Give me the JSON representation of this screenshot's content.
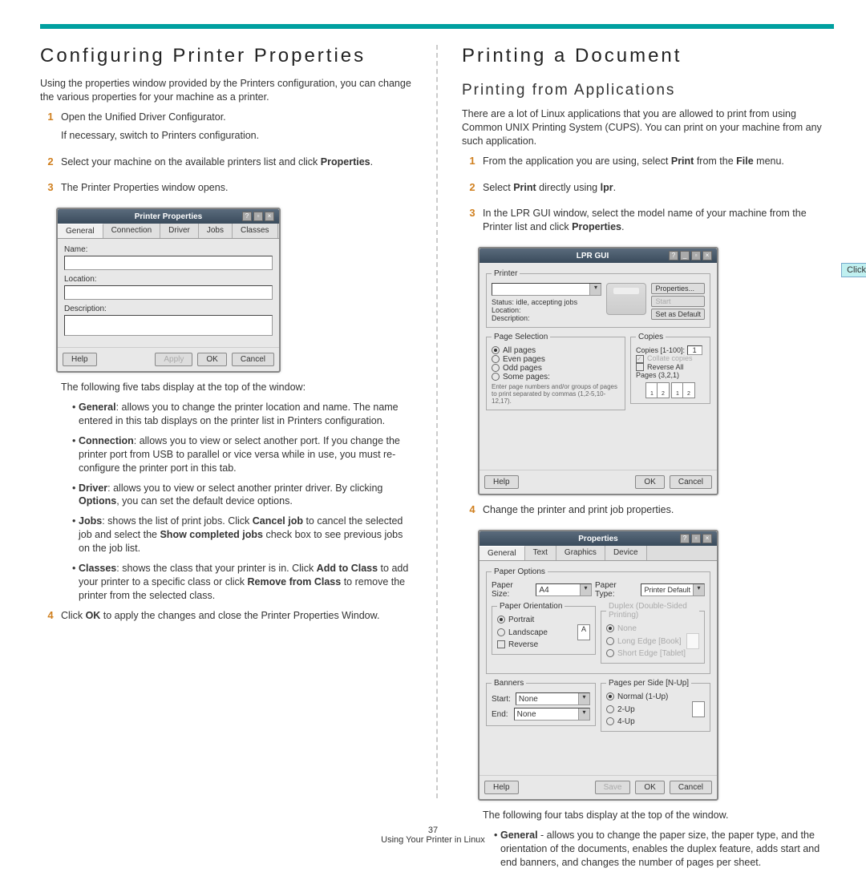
{
  "left": {
    "h1": "Configuring Printer Properties",
    "intro": "Using the properties window provided by the Printers configuration, you can change the various properties for your machine as a printer.",
    "step1a": "Open the Unified Driver Configurator.",
    "step1b": "If necessary, switch to Printers configuration.",
    "step2a": "Select your machine on the available printers list and click ",
    "step2b": "Properties",
    "step2c": ".",
    "step3": "The Printer Properties window opens.",
    "tabs_intro": "The following five tabs display at the top of the window:",
    "tab_general_b": "General",
    "tab_general": ": allows you to change the printer location and name. The name entered in this tab displays on the printer list in Printers configuration.",
    "tab_connection_b": "Connection",
    "tab_connection": ": allows you to view or select another port. If you change the printer port from USB to parallel or vice versa while in use, you must re-configure the printer port in this tab.",
    "tab_driver_b": "Driver",
    "tab_driver_a": ": allows you to view or select another printer driver. By clicking ",
    "tab_driver_opt": "Options",
    "tab_driver_c": ", you can set the default device options.",
    "tab_jobs_b": "Jobs",
    "tab_jobs_a": ": shows the list of print jobs. Click ",
    "tab_jobs_cancel": "Cancel job",
    "tab_jobs_c": " to cancel the selected job and select the ",
    "tab_jobs_show": "Show completed jobs",
    "tab_jobs_d": " check box to see previous jobs on the job list.",
    "tab_classes_b": "Classes",
    "tab_classes_a": ": shows the class that your printer is in. Click ",
    "tab_classes_add": "Add to Class",
    "tab_classes_c": " to add your printer to a specific class or click ",
    "tab_classes_rem": "Remove from Class",
    "tab_classes_d": " to remove the printer from the selected class.",
    "step4a": "Click ",
    "step4b": "OK",
    "step4c": " to apply the changes and close the Printer Properties Window."
  },
  "right": {
    "h1": "Printing a Document",
    "h2": "Printing from Applications",
    "intro": "There are a lot of Linux applications that you are allowed to print from using Common UNIX Printing System (CUPS). You can print on your machine from any such application.",
    "step1a": "From the application you are using, select ",
    "step1b": "Print",
    "step1c": " from the ",
    "step1d": "File",
    "step1e": " menu.",
    "step2a": "Select ",
    "step2b": "Print",
    "step2c": " directly using ",
    "step2d": "lpr",
    "step2e": ".",
    "step3a": "In the LPR GUI window, select the model name of your machine from the Printer list and click ",
    "step3b": "Properties",
    "step3c": ".",
    "callout": "Click.",
    "step4": "Change the printer and print job properties.",
    "tabs_intro": "The following four tabs display at the top of the window.",
    "tab_general_b": "General",
    "tab_general": " - allows you to change the paper size, the paper type, and the orientation of the documents, enables the duplex feature, adds start and end banners, and changes the number of pages per sheet."
  },
  "win1": {
    "title": "Printer Properties",
    "tabs": [
      "General",
      "Connection",
      "Driver",
      "Jobs",
      "Classes"
    ],
    "labels": {
      "name": "Name:",
      "location": "Location:",
      "description": "Description:"
    },
    "btns": {
      "help": "Help",
      "apply": "Apply",
      "ok": "OK",
      "cancel": "Cancel"
    }
  },
  "win2": {
    "title": "LPR GUI",
    "printer_legend": "Printer",
    "status": "Status: idle, accepting jobs",
    "location": "Location:",
    "description": "Description:",
    "props": "Properties...",
    "start": "Start",
    "setdefault": "Set as Default",
    "pagesel_legend": "Page Selection",
    "all": "All pages",
    "even": "Even pages",
    "odd": "Odd pages",
    "some": "Some pages:",
    "hint": "Enter page numbers and/or groups of pages to print separated by commas (1,2-5,10-12,17).",
    "copies_legend": "Copies",
    "copies_lbl": "Copies [1-100]:",
    "copies_val": "1",
    "collate": "Collate copies",
    "reverse": "Reverse All Pages (3,2,1)",
    "btns": {
      "help": "Help",
      "ok": "OK",
      "cancel": "Cancel"
    }
  },
  "win3": {
    "title": "Properties",
    "tabs": [
      "General",
      "Text",
      "Graphics",
      "Device"
    ],
    "paperopt_legend": "Paper Options",
    "papersize": "Paper Size:",
    "papersize_v": "A4",
    "papertype": "Paper Type:",
    "papertype_v": "Printer Default",
    "orient_legend": "Paper Orientation",
    "portrait": "Portrait",
    "landscape": "Landscape",
    "reverse": "Reverse",
    "duplex_legend": "Duplex (Double-Sided Printing)",
    "dnone": "None",
    "dlong": "Long Edge [Book]",
    "dshort": "Short Edge [Tablet]",
    "banners_legend": "Banners",
    "start": "Start:",
    "end": "End:",
    "none": "None",
    "pps_legend": "Pages per Side [N-Up]",
    "n1": "Normal (1-Up)",
    "n2": "2-Up",
    "n4": "4-Up",
    "btns": {
      "help": "Help",
      "save": "Save",
      "ok": "OK",
      "cancel": "Cancel"
    }
  },
  "footer": {
    "page": "37",
    "section": "Using Your Printer in Linux"
  }
}
